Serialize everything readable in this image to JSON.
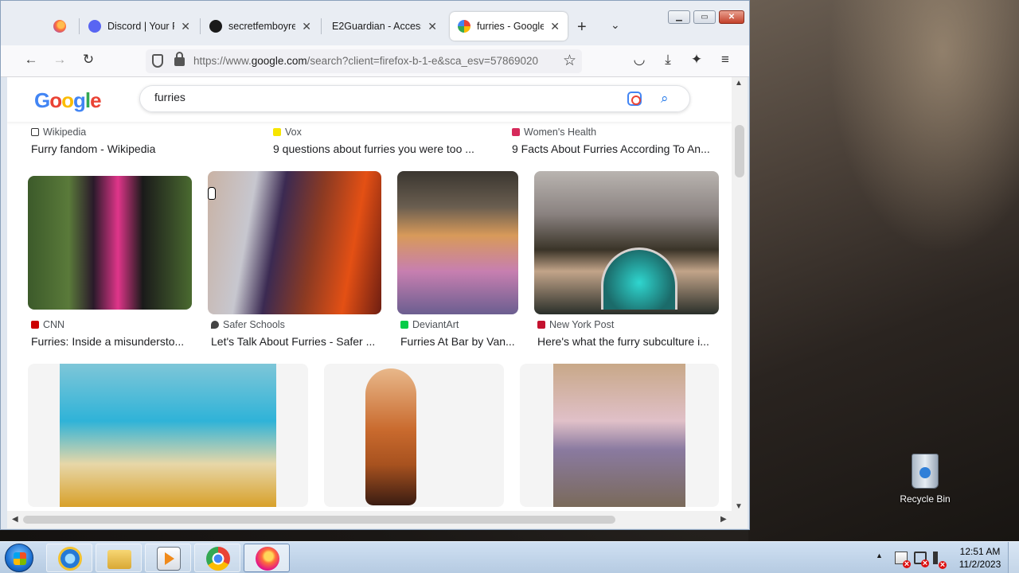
{
  "browser": {
    "tabs": [
      {
        "label": ""
      },
      {
        "label": "Discord | Your Pla"
      },
      {
        "label": "secretfemboyrepo"
      },
      {
        "label": "E2Guardian - Access D"
      },
      {
        "label": "furries - Google S"
      }
    ],
    "url_prefix": "https://www.",
    "url_domain": "google.com",
    "url_rest": "/search?client=firefox-b-1-e&sca_esv=57869020"
  },
  "google": {
    "logo": "Google",
    "query": "furries"
  },
  "results": {
    "row0": [
      {
        "source": "Wikipedia",
        "title": "Furry fandom - Wikipedia"
      },
      {
        "source": "Vox",
        "title": "9 questions about furries you were too ..."
      },
      {
        "source": "Women's Health",
        "title": "9 Facts About Furries According To An..."
      }
    ],
    "row1": [
      {
        "source": "CNN",
        "title": "Furries: Inside a misundersto..."
      },
      {
        "source": "Safer Schools",
        "title": "Let's Talk About Furries - Safer ..."
      },
      {
        "source": "DeviantArt",
        "title": "Furries At Bar by Van..."
      },
      {
        "source": "New York Post",
        "title": "Here's what the furry subculture i..."
      }
    ]
  },
  "desktop": {
    "recycle_bin": "Recycle Bin"
  },
  "taskbar": {
    "time": "12:51 AM",
    "date": "11/2/2023"
  },
  "colors": {
    "brand_blue": "#4285f4",
    "brand_red": "#ea4335",
    "brand_yellow": "#fbbc05",
    "brand_green": "#34a853"
  }
}
